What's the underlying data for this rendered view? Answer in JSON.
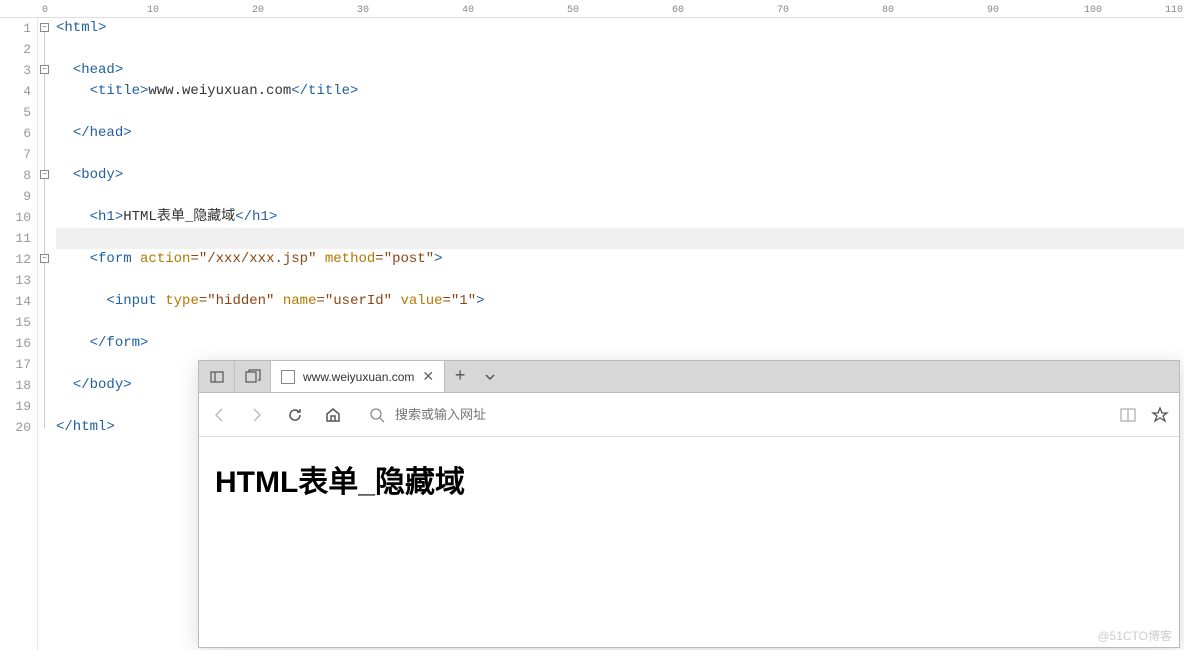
{
  "ruler_marks": [
    0,
    10,
    20,
    30,
    40,
    50,
    60,
    70,
    80,
    90,
    100,
    110
  ],
  "gutter": [
    "1",
    "2",
    "3",
    "4",
    "5",
    "6",
    "7",
    "8",
    "9",
    "10",
    "11",
    "12",
    "13",
    "14",
    "15",
    "16",
    "17",
    "18",
    "19",
    "20"
  ],
  "code": {
    "l1": {
      "t1": "<html>",
      "i": 0
    },
    "l3": {
      "t1": "<head>",
      "i": 1
    },
    "l4a": "<title>",
    "l4b": "www.weiyuxuan.com",
    "l4c": "</title>",
    "l6": {
      "t1": "</head>"
    },
    "l8": {
      "t1": "<body>"
    },
    "l10a": "<h1>",
    "l10b": "HTML表单_隐藏域",
    "l10c": "</h1>",
    "l12a": "<form ",
    "l12b": "action",
    "l12c": "=\"/xxx/xxx.jsp\" ",
    "l12d": "method",
    "l12e": "=\"post\"",
    "l12f": ">",
    "l14a": "<input ",
    "l14b": "type",
    "l14c": "=\"hidden\" ",
    "l14d": "name",
    "l14e": "=\"userId\" ",
    "l14f": "value",
    "l14g": "=\"1\"",
    "l14h": ">",
    "l16": "</form>",
    "l18": "</body>",
    "l20": "</html>"
  },
  "browser": {
    "tab_title": "www.weiyuxuan.com",
    "search_placeholder": "搜索或输入网址",
    "heading": "HTML表单_隐藏域"
  },
  "watermark": "@51CTO博客"
}
